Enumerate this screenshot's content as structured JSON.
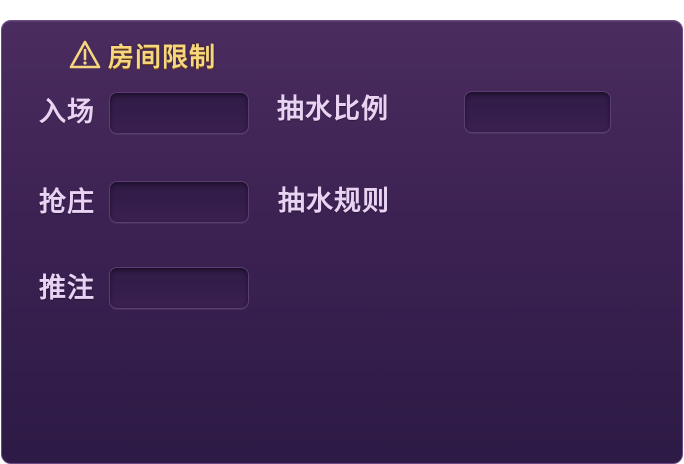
{
  "panel": {
    "title": "房间限制",
    "title_icon": "warning-triangle-icon"
  },
  "fields": {
    "entry": {
      "label": "入场",
      "value": ""
    },
    "banker": {
      "label": "抢庄",
      "value": ""
    },
    "push_bet": {
      "label": "推注",
      "value": ""
    },
    "rake_ratio": {
      "label": "抽水比例",
      "value": ""
    },
    "rake_rule": {
      "label": "抽水规则"
    }
  },
  "colors": {
    "panel_top": "#4b2c5f",
    "panel_bottom": "#2d1a45",
    "title": "#f6d77e",
    "label": "#e8d3f2"
  }
}
